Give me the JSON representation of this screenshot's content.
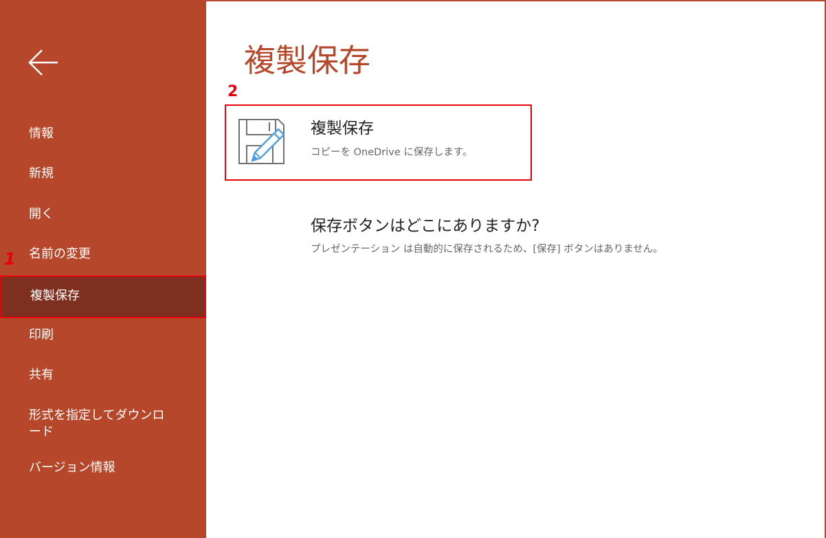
{
  "colors": {
    "sidebar": "#b7472a",
    "sidebar_active": "#7f2f1f",
    "annotation": "#e8000b",
    "title": "#b7472a",
    "icon_accent": "#4f9fe0"
  },
  "sidebar": {
    "back_icon": "arrow-left-icon",
    "items": [
      {
        "label": "情報"
      },
      {
        "label": "新規"
      },
      {
        "label": "開く"
      },
      {
        "label": "名前の変更"
      },
      {
        "label": "複製保存",
        "active": true
      },
      {
        "label": "印刷"
      },
      {
        "label": "共有"
      },
      {
        "label": "形式を指定してダウンロ",
        "label2": "ード"
      },
      {
        "label": "バージョン情報"
      }
    ]
  },
  "annotations": {
    "step1": "1",
    "step2": "2"
  },
  "main": {
    "title": "複製保存",
    "option": {
      "icon": "save-copy-icon",
      "title": "複製保存",
      "description": "コピーを OneDrive に保存します。"
    },
    "faq": {
      "title": "保存ボタンはどこにありますか?",
      "description": "プレゼンテーション は自動的に保存されるため、[保存] ボタンはありません。"
    }
  }
}
